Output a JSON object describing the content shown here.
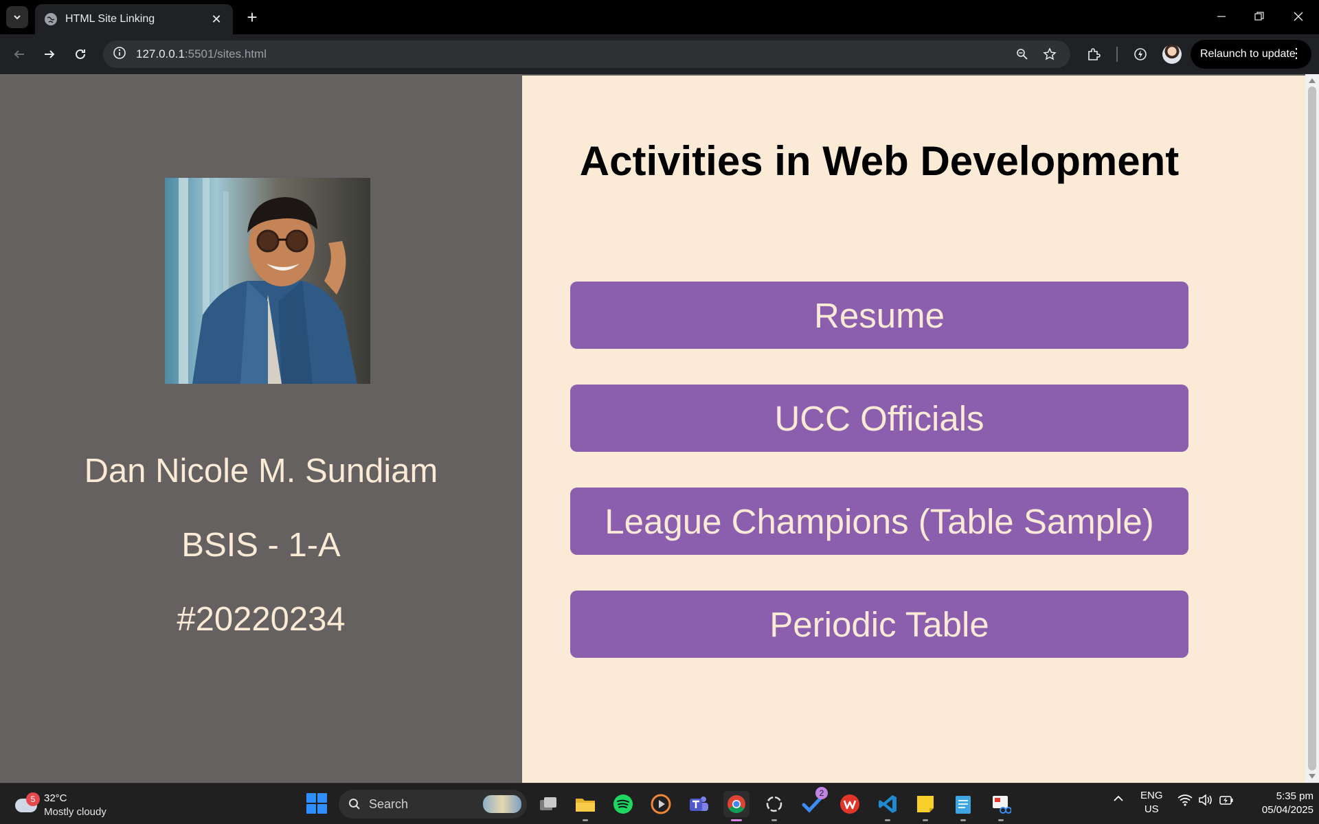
{
  "browser": {
    "tab_title": "HTML Site Linking",
    "url_host": "127.0.0.1",
    "url_path": ":5501/sites.html",
    "relaunch_label": "Relaunch to update"
  },
  "profile": {
    "name": "Dan Nicole M. Sundiam",
    "section": "BSIS - 1-A",
    "student_number": "#20220234"
  },
  "main": {
    "heading": "Activities in Web Development",
    "links": [
      {
        "label": "Resume"
      },
      {
        "label": "UCC Officials"
      },
      {
        "label": "League Champions (Table Sample)"
      },
      {
        "label": "Periodic Table"
      }
    ]
  },
  "colors": {
    "left_panel": "#656161",
    "right_panel": "#fbebd6",
    "button": "#8b5fad",
    "button_text": "#fbebd6"
  },
  "taskbar": {
    "weather_badge": "5",
    "weather_temp": "32°C",
    "weather_desc": "Mostly cloudy",
    "search_placeholder": "Search",
    "todo_badge": "2",
    "lang_line1": "ENG",
    "lang_line2": "US",
    "time": "5:35 pm",
    "date": "05/04/2025"
  }
}
